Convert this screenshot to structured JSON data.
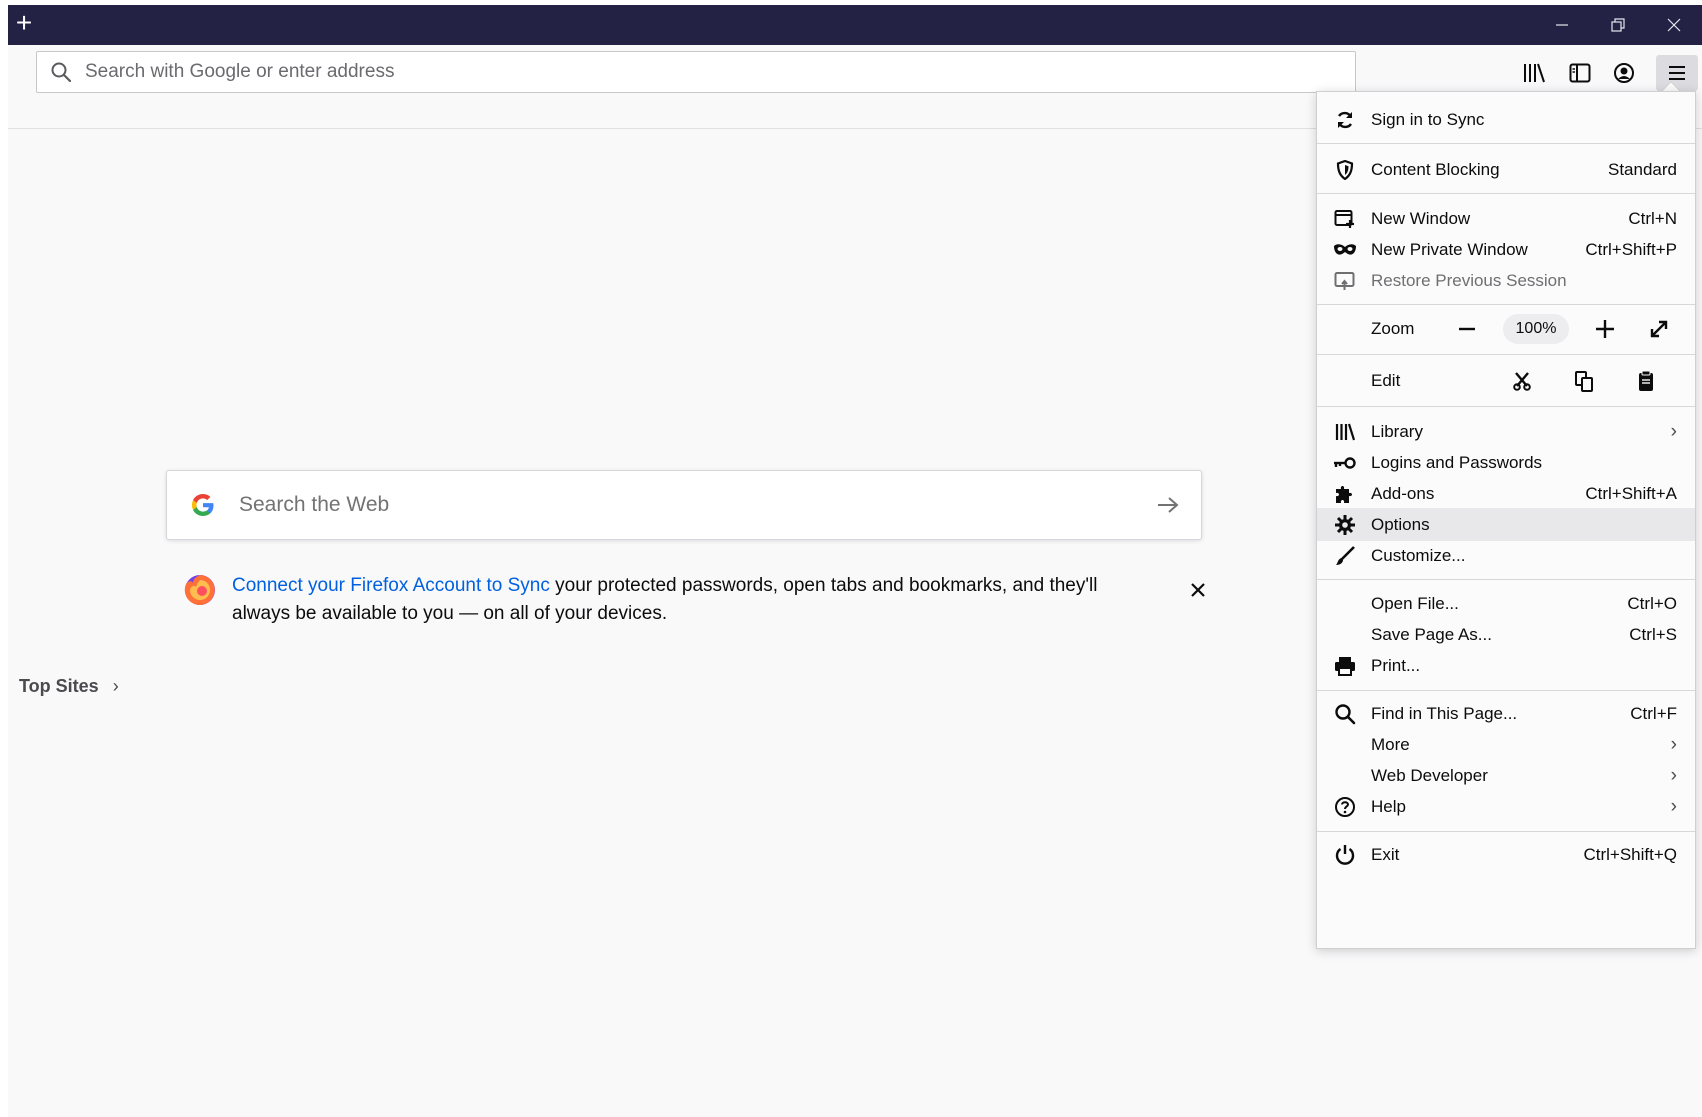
{
  "window": {
    "new_tab_label": "+",
    "controls": {
      "minimize": "minimize-icon",
      "restore": "restore-icon",
      "close": "close-icon"
    }
  },
  "toolbar": {
    "url_placeholder": "Search with Google or enter address",
    "icons": [
      "library-icon",
      "sidebar-icon",
      "account-icon",
      "hamburger-menu-icon"
    ]
  },
  "newtab": {
    "search_placeholder": "Search the Web",
    "promo_link": "Connect your Firefox Account to Sync",
    "promo_text": " your protected passwords, open tabs and bookmarks, and they'll always be available to you — on all of your devices.",
    "top_sites": "Top Sites",
    "top_sites_chevron": "›"
  },
  "menu": {
    "sign_in": "Sign in to Sync",
    "content_blocking": "Content Blocking",
    "content_blocking_value": "Standard",
    "new_window": "New Window",
    "new_window_sc": "Ctrl+N",
    "new_private": "New Private Window",
    "new_private_sc": "Ctrl+Shift+P",
    "restore_session": "Restore Previous Session",
    "zoom": "Zoom",
    "zoom_value": "100%",
    "edit": "Edit",
    "library": "Library",
    "logins": "Logins and Passwords",
    "addons": "Add-ons",
    "addons_sc": "Ctrl+Shift+A",
    "options": "Options",
    "customize": "Customize...",
    "open_file": "Open File...",
    "open_file_sc": "Ctrl+O",
    "save_page": "Save Page As...",
    "save_page_sc": "Ctrl+S",
    "print": "Print...",
    "find": "Find in This Page...",
    "find_sc": "Ctrl+F",
    "more": "More",
    "web_dev": "Web Developer",
    "help": "Help",
    "exit": "Exit",
    "exit_sc": "Ctrl+Shift+Q",
    "submenu_arrow": "›"
  },
  "colors": {
    "titlebar": "#232245",
    "link": "#0060df",
    "menu_hover": "#e8e8ea"
  }
}
